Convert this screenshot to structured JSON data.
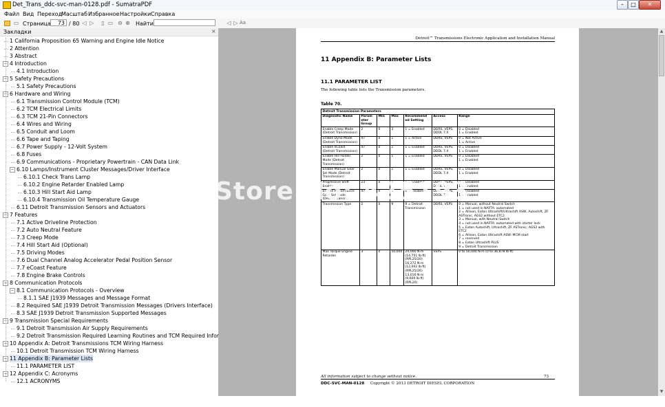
{
  "window": {
    "title": "Det_Trans_ddc-svc-man-0128.pdf - SumatraPDF"
  },
  "menu": [
    {
      "label": "Файл"
    },
    {
      "label": "Вид"
    },
    {
      "label": "Переход"
    },
    {
      "label": "Масштаб"
    },
    {
      "label": "Избранное"
    },
    {
      "label": "Настройки"
    },
    {
      "label": "Справка"
    }
  ],
  "toolbar": {
    "page_label": "Страница:",
    "page_value": "73",
    "page_total": "/ 80",
    "find_label": "Найти:",
    "find_value": ""
  },
  "sidebar": {
    "title": "Закладки",
    "items": [
      {
        "label": "1 California Proposition 65 Warning and Engine Idle Notice",
        "level": 0,
        "toggle": ""
      },
      {
        "label": "2 Attention",
        "level": 0,
        "toggle": ""
      },
      {
        "label": "3 Abstract",
        "level": 0,
        "toggle": ""
      },
      {
        "label": "4 Introduction",
        "level": 0,
        "toggle": "−"
      },
      {
        "label": "4.1 Introduction",
        "level": 1,
        "toggle": ""
      },
      {
        "label": "5 Safety Precautions",
        "level": 0,
        "toggle": "−"
      },
      {
        "label": "5.1 Safety Precautions",
        "level": 1,
        "toggle": ""
      },
      {
        "label": "6 Hardware and Wiring",
        "level": 0,
        "toggle": "−"
      },
      {
        "label": "6.1 Transmission Control Module (TCM)",
        "level": 1,
        "toggle": ""
      },
      {
        "label": "6.2 TCM Electrical Limits",
        "level": 1,
        "toggle": ""
      },
      {
        "label": "6.3 TCM 21-Pin Connectors",
        "level": 1,
        "toggle": ""
      },
      {
        "label": "6.4 Wires and Wiring",
        "level": 1,
        "toggle": ""
      },
      {
        "label": "6.5 Conduit and Loom",
        "level": 1,
        "toggle": ""
      },
      {
        "label": "6.6 Tape and Taping",
        "level": 1,
        "toggle": ""
      },
      {
        "label": "6.7 Power Supply - 12-Volt System",
        "level": 1,
        "toggle": ""
      },
      {
        "label": "6.8 Fuses",
        "level": 1,
        "toggle": ""
      },
      {
        "label": "6.9 Communications - Proprietary Powertrain - CAN Data Link",
        "level": 1,
        "toggle": ""
      },
      {
        "label": "6.10 Lamps/Instrument Cluster Messages/Driver Interface",
        "level": 1,
        "toggle": "−"
      },
      {
        "label": "6.10.1 Check Trans Lamp",
        "level": 2,
        "toggle": ""
      },
      {
        "label": "6.10.2 Engine Retarder Enabled Lamp",
        "level": 2,
        "toggle": ""
      },
      {
        "label": "6.10.3 Hill Start Aid Lamp",
        "level": 2,
        "toggle": ""
      },
      {
        "label": "6.10.4 Transmission Oil Temperature Gauge",
        "level": 2,
        "toggle": ""
      },
      {
        "label": "6.11 Detroit Transmission Sensors and Actuators",
        "level": 1,
        "toggle": ""
      },
      {
        "label": "7 Features",
        "level": 0,
        "toggle": "−"
      },
      {
        "label": "7.1 Active Driveline Protection",
        "level": 1,
        "toggle": ""
      },
      {
        "label": "7.2 Auto Neutral Feature",
        "level": 1,
        "toggle": ""
      },
      {
        "label": "7.3 Creep Mode",
        "level": 1,
        "toggle": ""
      },
      {
        "label": "7.4 Hill Start Aid (Optional)",
        "level": 1,
        "toggle": ""
      },
      {
        "label": "7.5 Driving Modes",
        "level": 1,
        "toggle": ""
      },
      {
        "label": "7.6 Dual Channel Analog Accelerator Pedal Position Sensor",
        "level": 1,
        "toggle": ""
      },
      {
        "label": "7.7 eCoast Feature",
        "level": 1,
        "toggle": ""
      },
      {
        "label": "7.8 Engine Brake Controls",
        "level": 1,
        "toggle": ""
      },
      {
        "label": "8 Communication Protocols",
        "level": 0,
        "toggle": "−"
      },
      {
        "label": "8.1 Communication Protocols - Overview",
        "level": 1,
        "toggle": "−"
      },
      {
        "label": "8.1.1 SAE J1939 Messages and Message Format",
        "level": 2,
        "toggle": ""
      },
      {
        "label": "8.2 Required SAE J1939 Detroit Transmission Messages (Drivers Interface)",
        "level": 1,
        "toggle": ""
      },
      {
        "label": "8.3 SAE J1939 Detroit Transmission Supported Messages",
        "level": 1,
        "toggle": ""
      },
      {
        "label": "9 Transmission Special Requirements",
        "level": 0,
        "toggle": "−"
      },
      {
        "label": "9.1 Detroit Transmission Air Supply Requirements",
        "level": 1,
        "toggle": ""
      },
      {
        "label": "9.2 Detroit Transmission Required Learning Routines and TCM Required Information",
        "level": 1,
        "toggle": ""
      },
      {
        "label": "10 Appendix A: Detroit Transmissions TCM Wiring Harness",
        "level": 0,
        "toggle": "−"
      },
      {
        "label": "10.1 Detroit Transmission TCM Wiring Harness",
        "level": 1,
        "toggle": ""
      },
      {
        "label": "11 Appendix B: Parameter Lists",
        "level": 0,
        "toggle": "−",
        "selected": true
      },
      {
        "label": "11.1 PARAMETER LIST",
        "level": 1,
        "toggle": ""
      },
      {
        "label": "12 Appendix C: Acronyms",
        "level": 0,
        "toggle": "−"
      },
      {
        "label": "12.1 ACRONYMS",
        "level": 1,
        "toggle": ""
      }
    ]
  },
  "document": {
    "header": "Detroit™ Transmissions Electronic Application and Installation Manual",
    "heading": "11   Appendix B: Parameter Lists",
    "subheading": "11.1   PARAMETER LIST",
    "intro": "The following table lists the Transmission parameters.",
    "table_caption": "Table 70.",
    "table_title": "Detroit Transmission Parameters",
    "columns": [
      "Diagnostic Name",
      "Param eter Group",
      "Min",
      "Max",
      "Recommend ed Setting",
      "Access",
      "Range"
    ],
    "rows": [
      [
        "Enable Creep Mode (Detroit Transmission)",
        "2",
        "0",
        "3",
        "1 = Enabled",
        "DDRS, VEPS, DDDL 7.X",
        "0 = Disabled\n1 = Enabled"
      ],
      [
        "Enable Dyno Mode (Detroit Transmission)",
        "47",
        "0",
        "1",
        "1 = Active",
        "DDRS, VEPS",
        "0 = Not Active\n1 = Active"
      ],
      [
        "Enable eCoast (Detroit Transmission)",
        "47",
        "0",
        "1",
        "1 = Enabled",
        "DDRS, VEPS, DDDL 7.X",
        "0 = Disabled\n1 = Enabled"
      ],
      [
        "Enable Hill Holder Mode (Detroit Transmission)",
        "2",
        "0",
        "1",
        "1 = Enabled",
        "DDRS, VEPS",
        "0 = Disabled\n1 = Enabled"
      ],
      [
        "Enable Manual Gear Sel Mode (Detroit Transmission)",
        "2",
        "0",
        "1",
        "1 = Enabled",
        "DDRS, VEPS, DDDL 7.X",
        "0 = Disabled\n1 = Enabled"
      ],
      [
        "Progressive Shift Enable",
        "23",
        "0",
        "1",
        "1 = Enabled",
        "DDRS, VEPS, DDDL 7.X",
        "0 = Disabled\n1 = Enabled"
      ],
      [
        "Enable Performance Gear Sel Mode (Detroit Transm)",
        "47",
        "0",
        "1",
        "0 = Disabled",
        "DDRS, VEPS, DDDL 7.X",
        "0 = Disabled\n1 = Enabled"
      ],
      [
        "Transmission Type",
        "2",
        "0",
        "9",
        "9 = Detroit Transmission",
        "DDRS, VEPS",
        "0 = Manual, without Neutral Switch\n1 = not used in NAFTA: automated\n2 = Allison, Eaton Ultrashift/Ultrashift ASW, Autoshift, ZF ASTronic, AGS2 without ETC2\n3 = Manual, with Neutral Switch\n4 = not used in NAFTA: automated with starter lock\n5 = Eaton Autoshift, Ultrashift, ZF ASTronic, AGS2 with ETC2\n6 = Allison, Eaton Ultrashift ASW: MCM start\n7 = reserved\n8 = Eaton Ultrashift PLUS\n9 = Detroit Transmission"
      ],
      [
        "Max Torque Engine Retarder",
        "3",
        "0",
        "50,000",
        "20,000 N·m (14,751 lb·ft) (RPL25/20)\n16,272 N·m (12,002 lb·ft) (RPL25/26)\n13,016 N·m (9,600 lb·ft) (RPL20)",
        "VEPS",
        "0 to 50,000 N·m (0 to 36,878 lb·ft)"
      ]
    ],
    "footer_note": "All information subject to change without notice.",
    "page_number": "73",
    "footer_doc": "DDC-SVC-MAN-0128",
    "footer_copy": "Copyright © 2013 DETROIT DIESEL CORPORATION"
  },
  "watermark": "Store No: 425193"
}
